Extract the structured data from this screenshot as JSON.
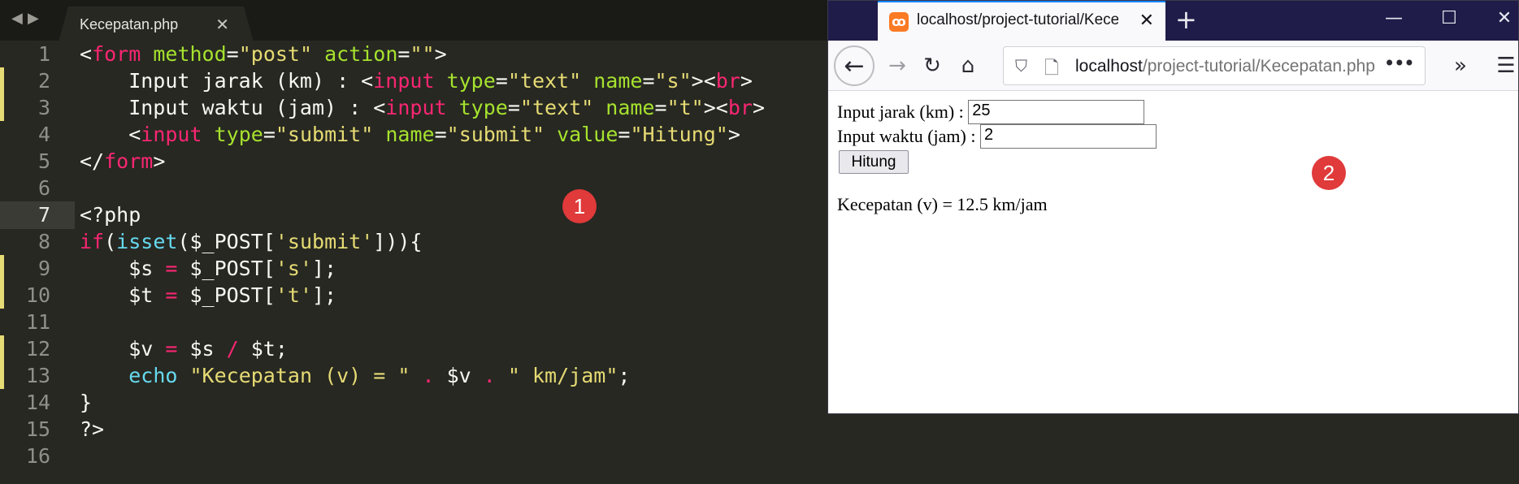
{
  "editor": {
    "tab_title": "Kecepatan.php",
    "close_glyph": "✕",
    "nav_back_glyph": "◀",
    "nav_forward_glyph": "▶",
    "line_numbers": [
      "1",
      "2",
      "3",
      "4",
      "5",
      "6",
      "7",
      "8",
      "9",
      "10",
      "11",
      "12",
      "13",
      "14",
      "15",
      "16"
    ],
    "active_line": 7,
    "modified_lines": [
      2,
      3,
      9,
      10,
      12,
      13
    ],
    "lines": [
      [
        [
          "tx",
          "<"
        ],
        [
          "tg",
          "form"
        ],
        [
          "tx",
          " "
        ],
        [
          "at",
          "method"
        ],
        [
          "tx",
          "="
        ],
        [
          "st",
          "\"post\""
        ],
        [
          "tx",
          " "
        ],
        [
          "at",
          "action"
        ],
        [
          "tx",
          "="
        ],
        [
          "st",
          "\"\""
        ],
        [
          "tx",
          ">"
        ]
      ],
      [
        [
          "tx",
          "    Input jarak (km) : <"
        ],
        [
          "tg",
          "input"
        ],
        [
          "tx",
          " "
        ],
        [
          "at",
          "type"
        ],
        [
          "tx",
          "="
        ],
        [
          "st",
          "\"text\""
        ],
        [
          "tx",
          " "
        ],
        [
          "at",
          "name"
        ],
        [
          "tx",
          "="
        ],
        [
          "st",
          "\"s\""
        ],
        [
          "tx",
          "><"
        ],
        [
          "tg",
          "br"
        ],
        [
          "tx",
          ">"
        ]
      ],
      [
        [
          "tx",
          "    Input waktu (jam) : <"
        ],
        [
          "tg",
          "input"
        ],
        [
          "tx",
          " "
        ],
        [
          "at",
          "type"
        ],
        [
          "tx",
          "="
        ],
        [
          "st",
          "\"text\""
        ],
        [
          "tx",
          " "
        ],
        [
          "at",
          "name"
        ],
        [
          "tx",
          "="
        ],
        [
          "st",
          "\"t\""
        ],
        [
          "tx",
          "><"
        ],
        [
          "tg",
          "br"
        ],
        [
          "tx",
          ">"
        ]
      ],
      [
        [
          "tx",
          "    <"
        ],
        [
          "tg",
          "input"
        ],
        [
          "tx",
          " "
        ],
        [
          "at",
          "type"
        ],
        [
          "tx",
          "="
        ],
        [
          "st",
          "\"submit\""
        ],
        [
          "tx",
          " "
        ],
        [
          "at",
          "name"
        ],
        [
          "tx",
          "="
        ],
        [
          "st",
          "\"submit\""
        ],
        [
          "tx",
          " "
        ],
        [
          "at",
          "value"
        ],
        [
          "tx",
          "="
        ],
        [
          "st",
          "\"Hitung\""
        ],
        [
          "tx",
          ">"
        ]
      ],
      [
        [
          "tx",
          "</"
        ],
        [
          "tg",
          "form"
        ],
        [
          "tx",
          ">"
        ]
      ],
      [],
      [
        [
          "tx",
          "<?php"
        ]
      ],
      [
        [
          "tg",
          "if"
        ],
        [
          "tx",
          "("
        ],
        [
          "fn",
          "isset"
        ],
        [
          "tx",
          "($_POST["
        ],
        [
          "st",
          "'submit'"
        ],
        [
          "tx",
          "])){"
        ]
      ],
      [
        [
          "tx",
          "    $s "
        ],
        [
          "op",
          "="
        ],
        [
          "tx",
          " $_POST["
        ],
        [
          "st",
          "'s'"
        ],
        [
          "tx",
          "];"
        ]
      ],
      [
        [
          "tx",
          "    $t "
        ],
        [
          "op",
          "="
        ],
        [
          "tx",
          " $_POST["
        ],
        [
          "st",
          "'t'"
        ],
        [
          "tx",
          "];"
        ]
      ],
      [],
      [
        [
          "tx",
          "    $v "
        ],
        [
          "op",
          "="
        ],
        [
          "tx",
          " $s "
        ],
        [
          "op",
          "/"
        ],
        [
          "tx",
          " $t;"
        ]
      ],
      [
        [
          "tx",
          "    "
        ],
        [
          "fn",
          "echo"
        ],
        [
          "tx",
          " "
        ],
        [
          "st",
          "\"Kecepatan (v) = \""
        ],
        [
          "tx",
          " "
        ],
        [
          "op",
          "."
        ],
        [
          "tx",
          " $v "
        ],
        [
          "op",
          "."
        ],
        [
          "tx",
          " "
        ],
        [
          "st",
          "\" km/jam\""
        ],
        [
          "tx",
          ";"
        ]
      ],
      [
        [
          "tx",
          "}"
        ]
      ],
      [
        [
          "tx",
          "?>"
        ]
      ],
      []
    ],
    "badge": "1"
  },
  "browser": {
    "tab_title": "localhost/project-tutorial/Kecepatan.php",
    "tab_close_glyph": "✕",
    "new_tab_glyph": "+",
    "window_controls": {
      "minimize": "—",
      "maximize": "☐",
      "close": "✕"
    },
    "toolbar": {
      "back_glyph": "←",
      "forward_glyph": "→",
      "reload_glyph": "↻",
      "home_glyph": "⌂",
      "overflow_glyph": "»",
      "menu_glyph": "☰"
    },
    "url": {
      "host": "localhost",
      "path": "/project-tutorial/Kecepatan.php",
      "shield_glyph": "⛉",
      "page_glyph": "🗋",
      "menu_glyph": "•••"
    },
    "page": {
      "jarak_label": "Input jarak (km) :",
      "jarak_value": "25",
      "waktu_label": "Input waktu (jam) :",
      "waktu_value": "2",
      "submit_label": "Hitung",
      "result": "Kecepatan (v) = 12.5 km/jam"
    },
    "badge": "2"
  },
  "colors": {
    "editor_bg": "#272822",
    "tag": "#f92672",
    "attr": "#a6e22e",
    "string": "#e6db74",
    "func": "#66d9ef",
    "browser_titlebar": "#1f1c4a",
    "tab_accent": "#0a84ff",
    "badge": "#e03a3a"
  },
  "icons": [
    "nav-back-icon",
    "nav-forward-icon",
    "close-icon",
    "xampp-favicon-icon",
    "back-arrow-icon",
    "forward-arrow-icon",
    "reload-icon",
    "home-icon",
    "shield-icon",
    "page-icon",
    "overflow-icon",
    "hamburger-menu-icon"
  ]
}
